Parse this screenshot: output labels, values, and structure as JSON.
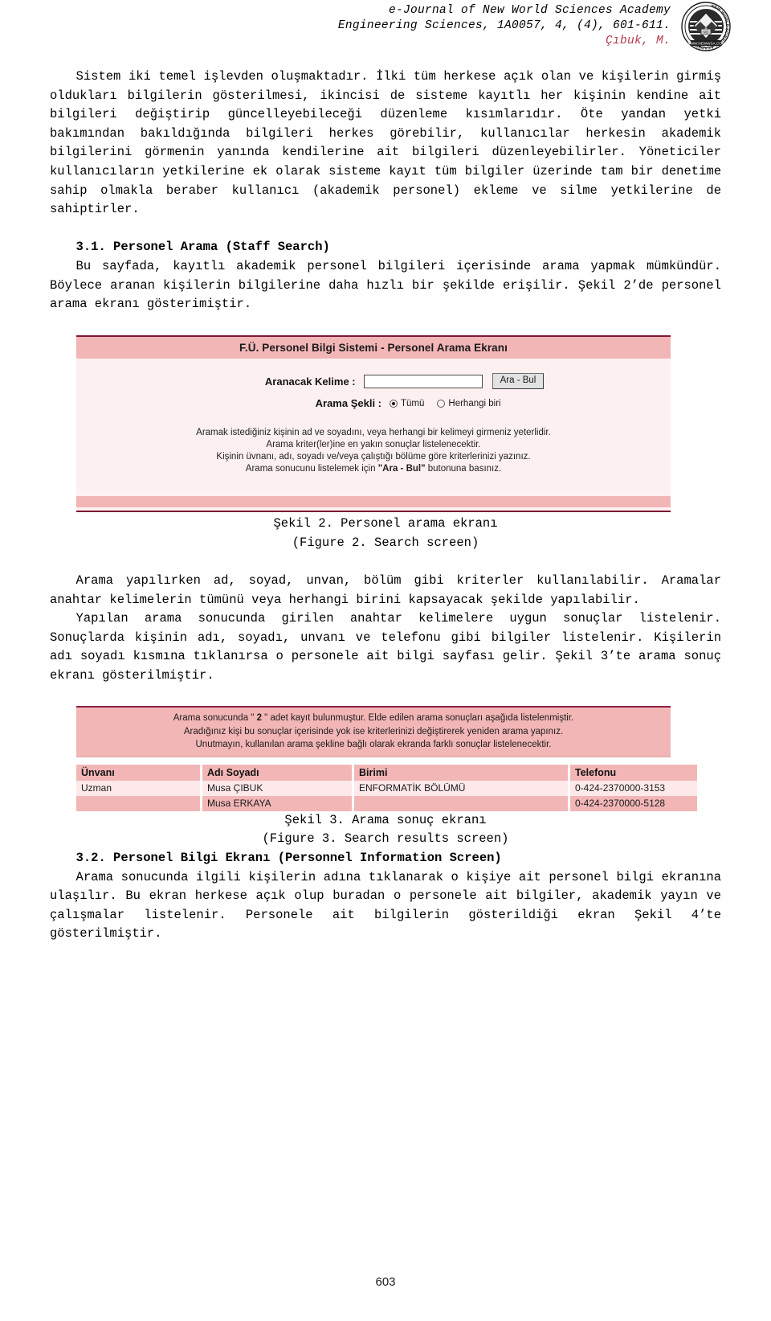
{
  "header": {
    "line1": "e-Journal of New World Sciences Academy",
    "line2": "Engineering Sciences, 1A0057, 4, (4), 601-611.",
    "line3": "Çıbuk, M.",
    "logo_alt": "new-world-sciences-academy-logo",
    "logo_ring_text": "NEW WORLD SCIENCES ACADEMY",
    "logo_url_text": "WWW.NEWWSA.COM"
  },
  "body": {
    "p1": "Sistem iki temel işlevden oluşmaktadır. İlki tüm herkese açık olan ve kişilerin girmiş oldukları bilgilerin gösterilmesi, ikincisi de sisteme kayıtlı her kişinin kendine ait bilgileri değiştirip güncelleyebileceği düzenleme kısımlarıdır. Öte yandan yetki bakımından bakıldığında bilgileri herkes görebilir, kullanıcılar herkesin akademik bilgilerini görmenin yanında kendilerine ait bilgileri düzenleyebilirler. Yöneticiler kullanıcıların yetkilerine ek olarak sisteme kayıt tüm bilgiler üzerinde tam bir denetime sahip olmakla beraber kullanıcı (akademik personel) ekleme ve silme yetkilerine de sahiptirler.",
    "h31": "3.1. Personel Arama (Staff Search)",
    "p2": "Bu sayfada, kayıtlı akademik personel bilgileri içerisinde arama yapmak mümkündür. Böylece aranan kişilerin bilgilerine daha hızlı bir şekilde erişilir. Şekil 2’de personel arama ekranı gösterimiştir.",
    "p3": "Arama yapılırken ad, soyad, unvan, bölüm gibi kriterler kullanılabilir. Aramalar anahtar kelimelerin tümünü veya herhangi birini kapsayacak şekilde yapılabilir.",
    "p4": "Yapılan arama sonucunda girilen anahtar kelimelere uygun sonuçlar listelenir. Sonuçlarda kişinin adı, soyadı, unvanı ve telefonu gibi bilgiler listelenir. Kişilerin adı soyadı kısmına tıklanırsa o personele ait bilgi sayfası gelir. Şekil 3’te arama sonuç ekranı gösterilmiştir.",
    "h32": "3.2. Personel Bilgi Ekranı (Personnel Information Screen)",
    "p5": "Arama sonucunda ilgili kişilerin adına tıklanarak o kişiye ait personel bilgi ekranına ulaşılır. Bu ekran herkese açık olup buradan o personele ait bilgiler, akademik yayın ve çalışmalar listelenir. Personele ait bilgilerin gösterildiği ekran Şekil 4’te gösterilmiştir."
  },
  "figure2": {
    "screen": {
      "title": "F.Ü. Personel Bilgi Sistemi - Personel Arama Ekranı",
      "keyword_label": "Aranacak Kelime  :",
      "keyword_value": "",
      "keyword_placeholder": "",
      "find_button": "Ara - Bul",
      "mode_label": "Arama Şekli  :",
      "radio_all": "Tümü",
      "radio_any": "Herhangi biri",
      "radio_selected": "Tümü",
      "help_line1": "Aramak istediğiniz kişinin ad ve soyadını, veya herhangi bir kelimeyi girmeniz yeterlidir.",
      "help_line2": "Arama kriter(ler)ine en yakın sonuçlar listelenecektir.",
      "help_line3": "Kişinin üvnanı, adı, soyadı ve/veya çalıştığı bölüme göre kriterlerinizi yazınız.",
      "help_line4_pre": "Arama sonucunu listelemek için ",
      "help_line4_bold": "\"Ara - Bul\"",
      "help_line4_post": " butonuna basınız."
    },
    "caption_tr": "Şekil 2. Personel arama ekranı",
    "caption_en": "(Figure 2. Search screen)"
  },
  "figure3": {
    "screen": {
      "msg_line1_pre": "Arama sonucunda \" ",
      "msg_line1_count": "2",
      "msg_line1_post": " \" adet kayıt bulunmuştur. Elde edilen arama sonuçları aşağıda listelenmiştir.",
      "msg_line2": "Aradığınız kişi bu sonuçlar içerisinde yok ise kriterlerinizi değiştirerek yeniden arama yapınız.",
      "msg_line3": "Unutmayın, kullanılan arama şekline bağlı olarak ekranda farklı sonuçlar listelenecektir.",
      "columns": [
        "Ünvanı",
        "Adı Soyadı",
        "Birimi",
        "Telefonu"
      ],
      "rows": [
        [
          "Uzman",
          "Musa ÇIBUK",
          "ENFORMATİK BÖLÜMÜ",
          "0-424-2370000-3153"
        ],
        [
          "",
          "Musa ERKAYA",
          "",
          "0-424-2370000-5128"
        ]
      ]
    },
    "caption_tr": "Şekil 3. Arama sonuç ekranı",
    "caption_en": "(Figure 3. Search results screen)"
  },
  "footer": {
    "page_number": "603"
  },
  "colors": {
    "accent_dark": "#7c1834",
    "panel_pink": "#f3b6b6",
    "panel_light": "#fdf0f0",
    "row_light": "#fde9e9",
    "header_accent": "#b33b4e"
  }
}
